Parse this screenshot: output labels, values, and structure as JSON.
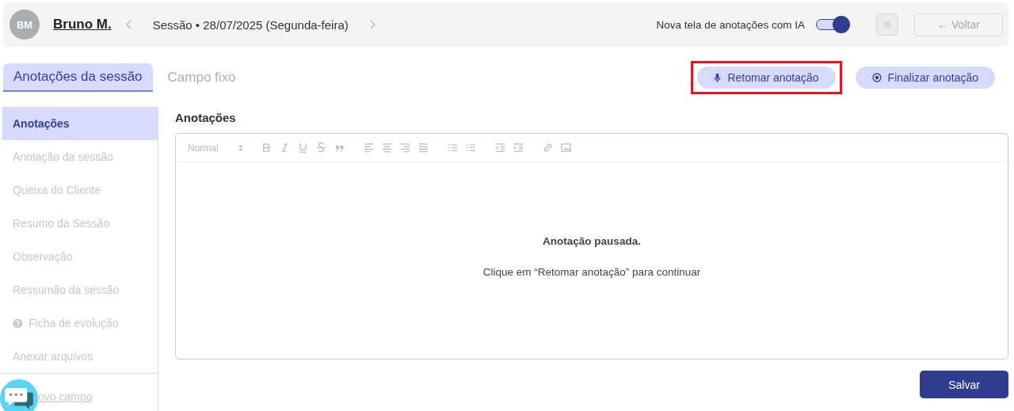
{
  "header": {
    "avatar": "BM",
    "patient": "Bruno M.",
    "session": "Sessão • 28/07/2025 (Segunda-feira)",
    "ai_toggle": {
      "label": "Nova tela de anotações com IA",
      "on": true
    },
    "settings_disabled": true,
    "back": {
      "label": "← Voltar",
      "disabled": true
    }
  },
  "tabs": [
    {
      "label": "Anotações da sessão",
      "selected": true
    },
    {
      "label": "Campo fixo",
      "selected": false
    }
  ],
  "actions": [
    {
      "label": "Retomar anotação",
      "kind": "mic",
      "highlighted": true
    },
    {
      "label": "Finalizar anotação",
      "kind": "stop",
      "highlighted": false
    }
  ],
  "sidebar": {
    "items": [
      {
        "label": "Anotações",
        "kind": "plain",
        "selected": true
      },
      {
        "label": "Anotação da sessão",
        "kind": "plain",
        "selected": false
      },
      {
        "label": "Queixa do Cliente",
        "kind": "plain",
        "selected": false
      },
      {
        "label": "Resumo da Sessão",
        "kind": "plain",
        "selected": false
      },
      {
        "label": "Observação",
        "kind": "plain",
        "selected": false
      },
      {
        "label": "Ressumão da sessão",
        "kind": "plain",
        "selected": false
      },
      {
        "label": "Ficha de evolução",
        "kind": "help",
        "selected": false
      },
      {
        "label": "Anexar arquivos",
        "kind": "plain",
        "selected": false
      }
    ],
    "footer_link": "ovo campo"
  },
  "editor": {
    "title": "Anotações",
    "format": "Normal",
    "message_title": "Anotação pausada.",
    "message": "Clique em “Retomar anotação” para continuar"
  },
  "save_button": "Salvar"
}
